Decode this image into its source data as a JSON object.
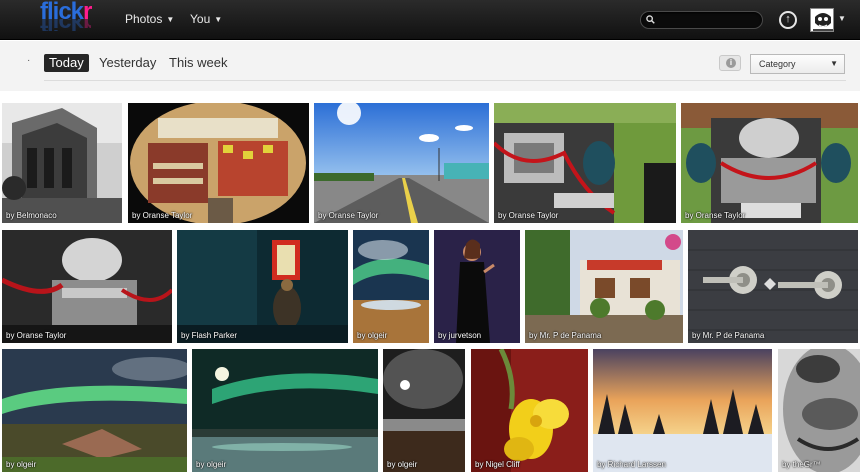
{
  "brand": {
    "logo_part1": "flick",
    "logo_part2": "r"
  },
  "nav": {
    "photos": "Photos",
    "you": "You"
  },
  "search": {
    "placeholder": ""
  },
  "subnav": {
    "tabs": [
      {
        "label": "Today",
        "active": true
      },
      {
        "label": "Yesterday",
        "active": false
      },
      {
        "label": "This week",
        "active": false
      }
    ],
    "category_select": "Category"
  },
  "photos": [
    {
      "credit": "by Belmonaco"
    },
    {
      "credit": "by Oranse Taylor"
    },
    {
      "credit": "by Oranse Taylor"
    },
    {
      "credit": "by Oranse Taylor"
    },
    {
      "credit": "by Oranse Taylor"
    },
    {
      "credit": "by Oranse Taylor"
    },
    {
      "credit": "by Flash Parker"
    },
    {
      "credit": "by olgeir"
    },
    {
      "credit": "by jurvetson"
    },
    {
      "credit": "by Mr. P de Panama"
    },
    {
      "credit": "by Mr. P de Panama"
    },
    {
      "credit": "by olgeir"
    },
    {
      "credit": "by olgeir"
    },
    {
      "credit": "by olgeir"
    },
    {
      "credit": "by Nigel Cliff"
    },
    {
      "credit": "by Richard Larssen"
    },
    {
      "credit": "by theGr™"
    }
  ]
}
